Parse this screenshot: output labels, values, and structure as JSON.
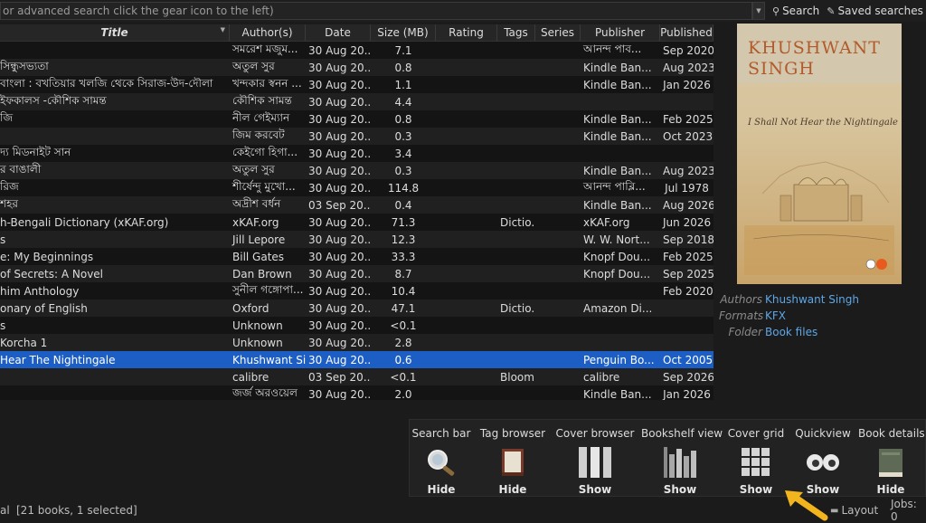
{
  "search": {
    "placeholder": "or advanced search click the gear icon to the left)",
    "search_label": "Search",
    "saved_label": "Saved searches"
  },
  "columns": [
    "Title",
    "Author(s)",
    "Date",
    "Size (MB)",
    "Rating",
    "Tags",
    "Series",
    "Publisher",
    "Published"
  ],
  "rows": [
    {
      "title": "",
      "author": "সমরেশ মজুম...",
      "date": "30 Aug 20...",
      "size": "7.1",
      "tags": "",
      "pub": "আনন্দ পাব...",
      "published": "Sep 2020"
    },
    {
      "title": "সিন্ধুসভ্যতা",
      "author": "অতুল সুর",
      "date": "30 Aug 20...",
      "size": "0.8",
      "tags": "",
      "pub": "Kindle Ban...",
      "published": "Aug 2023"
    },
    {
      "title": "বাংলা : বখতিয়ার খলজি থেকে সিরাজ-উদ-দৌলা",
      "author": "খন্দকার স্বনন ...",
      "date": "30 Aug 20...",
      "size": "1.1",
      "tags": "",
      "pub": "Kindle Ban...",
      "published": "Jan 2026"
    },
    {
      "title": "ইফকালস -কৌশিক সামন্ত",
      "author": "কৌশিক সামন্ত",
      "date": "30 Aug 20...",
      "size": "4.4",
      "tags": "",
      "pub": "",
      "published": ""
    },
    {
      "title": "জি",
      "author": "নীল গেইম্যান",
      "date": "30 Aug 20...",
      "size": "0.8",
      "tags": "",
      "pub": "Kindle Ban...",
      "published": "Feb 2025"
    },
    {
      "title": "",
      "author": "জিম করবেট",
      "date": "30 Aug 20...",
      "size": "0.3",
      "tags": "",
      "pub": "Kindle Ban...",
      "published": "Oct 2023"
    },
    {
      "title": "দ্য মিডনাইট সান",
      "author": "কেইগো হিগা...",
      "date": "30 Aug 20...",
      "size": "3.4",
      "tags": "",
      "pub": "",
      "published": ""
    },
    {
      "title": "র বাঙালী",
      "author": "অতুল সুর",
      "date": "30 Aug 20...",
      "size": "0.3",
      "tags": "",
      "pub": "Kindle Ban...",
      "published": "Aug 2023"
    },
    {
      "title": "রিজ",
      "author": "শীর্ষেন্দু মুখো...",
      "date": "30 Aug 20...",
      "size": "114.8",
      "tags": "",
      "pub": "আনন্দ পাব্লি...",
      "published": "Jul 1978"
    },
    {
      "title": "শহর",
      "author": "অদ্রীশ বর্ধন",
      "date": "03 Sep 20...",
      "size": "0.4",
      "tags": "",
      "pub": "Kindle Ban...",
      "published": "Aug 2026"
    },
    {
      "title": "h-Bengali Dictionary (xKAF.org)",
      "author": "xKAF.org",
      "date": "30 Aug 20...",
      "size": "71.3",
      "tags": "Dictio...",
      "pub": "xKAF.org",
      "published": "Jun 2026"
    },
    {
      "title": "s",
      "author": "Jill Lepore",
      "date": "30 Aug 20...",
      "size": "12.3",
      "tags": "",
      "pub": "W. W. Nort...",
      "published": "Sep 2018"
    },
    {
      "title": "e: My Beginnings",
      "author": "Bill Gates",
      "date": "30 Aug 20...",
      "size": "33.3",
      "tags": "",
      "pub": "Knopf Dou...",
      "published": "Feb 2025"
    },
    {
      "title": "of Secrets: A Novel",
      "author": "Dan Brown",
      "date": "30 Aug 20...",
      "size": "8.7",
      "tags": "",
      "pub": "Knopf Dou...",
      "published": "Sep 2025"
    },
    {
      "title": "him Anthology",
      "author": "সুনীল গঙ্গোপা...",
      "date": "30 Aug 20...",
      "size": "10.4",
      "tags": "",
      "pub": "",
      "published": "Feb 2020"
    },
    {
      "title": "onary of English",
      "author": "Oxford",
      "date": "30 Aug 20...",
      "size": "47.1",
      "tags": "Dictio...",
      "pub": "Amazon Di...",
      "published": ""
    },
    {
      "title": "s",
      "author": "Unknown",
      "date": "30 Aug 20...",
      "size": "<0.1",
      "tags": "",
      "pub": "",
      "published": ""
    },
    {
      "title": "Korcha 1",
      "author": "Unknown",
      "date": "30 Aug 20...",
      "size": "2.8",
      "tags": "",
      "pub": "",
      "published": ""
    },
    {
      "title": "Hear The Nightingale",
      "author": "Khushwant Si...",
      "date": "30 Aug 20...",
      "size": "0.6",
      "tags": "",
      "pub": "Penguin Bo...",
      "published": "Oct 2005",
      "selected": true
    },
    {
      "title": "",
      "author": "calibre",
      "date": "03 Sep 20...",
      "size": "<0.1",
      "tags": "Bloom...",
      "pub": "calibre",
      "published": "Sep 2026"
    },
    {
      "title": "",
      "author": "জর্জ অরওয়েল",
      "date": "30 Aug 20...",
      "size": "2.0",
      "tags": "",
      "pub": "Kindle Ban...",
      "published": "Jan 2026"
    }
  ],
  "details": {
    "cover_author": "KHUSHWANT SINGH",
    "cover_title": "I Shall Not Hear the Nightingale",
    "authors_label": "Authors",
    "authors_value": "Khushwant Singh",
    "formats_label": "Formats",
    "formats_value": "KFX",
    "folder_label": "Folder",
    "folder_value": "Book files"
  },
  "layout_panel": [
    {
      "label": "Search bar",
      "action": "Hide",
      "icon": "magnifier-icon"
    },
    {
      "label": "Tag browser",
      "action": "Hide",
      "icon": "book-icon"
    },
    {
      "label": "Cover browser",
      "action": "Show",
      "icon": "cover-browser-icon"
    },
    {
      "label": "Bookshelf view",
      "action": "Show",
      "icon": "bookshelf-icon"
    },
    {
      "label": "Cover grid",
      "action": "Show",
      "icon": "grid-icon"
    },
    {
      "label": "Quickview",
      "action": "Show",
      "icon": "eyes-icon"
    },
    {
      "label": "Book details",
      "action": "Hide",
      "icon": "closed-book-icon"
    }
  ],
  "status": {
    "left": "al",
    "count": "[21 books, 1 selected]",
    "layout_label": "Layout",
    "jobs": "Jobs: 0"
  },
  "colors": {
    "selection": "#1c5ec4",
    "link": "#5ea6e6",
    "annotation_arrow": "#f2b51d"
  }
}
